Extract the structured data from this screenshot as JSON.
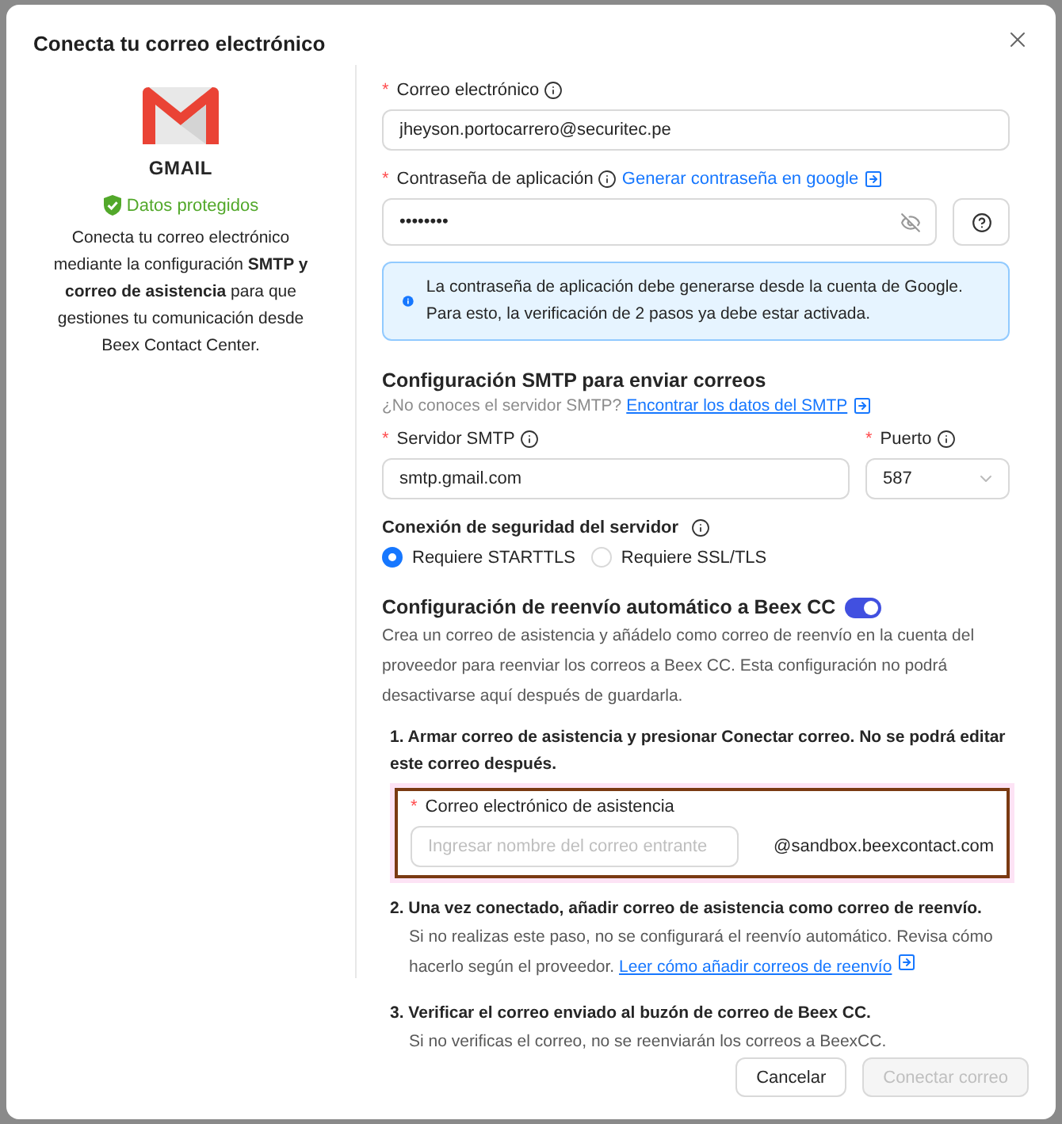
{
  "dialog": {
    "title": "Conecta tu correo electrónico"
  },
  "provider": {
    "name": "GMAIL",
    "badge": "Datos protegidos",
    "description": "Conecta tu correo electrónico mediante la configuración **SMTP y correo de asistencia** para que gestiones tu comunicación desde Beex Contact Center."
  },
  "email": {
    "mark": "*",
    "label": "Correo electrónico",
    "value": "jheyson.portocarrero@securitec.pe"
  },
  "password": {
    "mark": "*",
    "label": "Contraseña de aplicación",
    "link": "Generar contraseña en google",
    "value": "••••••••"
  },
  "alert": "La contraseña de aplicación debe generarse desde la cuenta de Google. Para esto, la verificación de 2 pasos ya debe estar activada.",
  "smtp": {
    "title": "Configuración SMTP para enviar correos",
    "hint": "¿No conoces el servidor SMTP?",
    "link": "Encontrar los datos del SMTP",
    "server": {
      "mark": "*",
      "label": "Servidor SMTP",
      "value": "smtp.gmail.com"
    },
    "port": {
      "mark": "*",
      "label": "Puerto",
      "value": "587"
    },
    "security_label": "Conexión de seguridad del servidor",
    "options": [
      {
        "label": "Requiere STARTTLS",
        "selected": true
      },
      {
        "label": "Requiere SSL/TLS",
        "selected": false
      }
    ]
  },
  "forwarding": {
    "title": "Configuración de reenvío automático a Beex CC",
    "on": true,
    "description": "Crea un correo de asistencia y añádelo como correo de reenvío en la cuenta del proveedor para reenviar los correos a Beex CC. Esta configuración no podrá desactivarse aquí después de guardarla.",
    "steps": [
      {
        "title": "1. Armar correo de asistencia y presionar Conectar correo. No se podrá editar este correo después.",
        "field": {
          "mark": "*",
          "label": "Correo electrónico de asistencia",
          "placeholder": "Ingresar nombre del correo entrante",
          "suffix": "@sandbox.beexcontact.com"
        }
      },
      {
        "title": "2. Una vez conectado, añadir correo de asistencia como correo de reenvío.",
        "text": "Si no realizas este paso, no se configurará el reenvío automático. Revisa cómo hacerlo según el proveedor.",
        "link": "Leer cómo añadir correos de reenvío"
      },
      {
        "title": "3. Verificar el correo enviado al buzón de correo de Beex CC.",
        "text": "Si no verificas el correo, no se reenviarán los correos a BeexCC."
      }
    ]
  },
  "buttons": [
    {
      "label": "Cancelar",
      "disabled": false
    },
    {
      "label": "Conectar correo",
      "disabled": true
    }
  ]
}
